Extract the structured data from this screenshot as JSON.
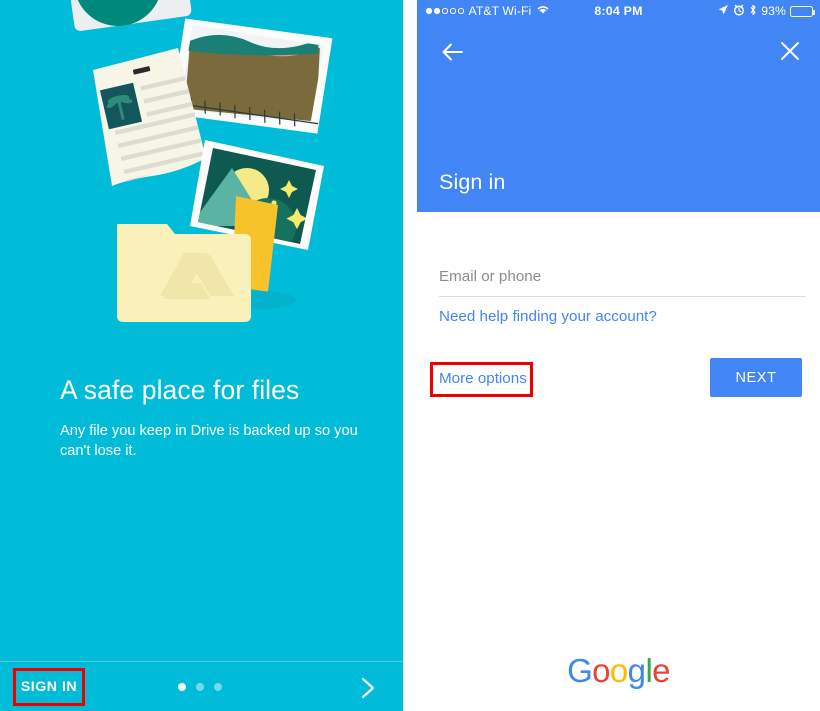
{
  "colors": {
    "teal_bg": "#00bcd8",
    "google_blue": "#4285f4",
    "highlight_red": "#ee0000",
    "white": "#ffffff",
    "hint_gray": "#8c8c8c",
    "divider_gray": "#dddddd",
    "google_red": "#ea4335",
    "google_yellow": "#fbbc05",
    "google_green": "#34a853"
  },
  "left_panel": {
    "name": "drive-onboarding-slide",
    "illustration_name": "files-folder-illustration",
    "headline": "A safe place for files",
    "subtext": "Any file you keep in Drive is backed up so you can't lose it.",
    "sign_in_label": "SIGN IN",
    "sign_in_highlighted": true,
    "pagination": {
      "total": 3,
      "active_index": 0
    },
    "next_arrow_icon": "chevron-right-icon"
  },
  "right_panel": {
    "status_bar": {
      "signal_dots_filled": 2,
      "signal_dots_total": 5,
      "carrier": "AT&T Wi-Fi",
      "wifi_icon": "wifi-icon",
      "time": "8:04 PM",
      "location_icon": "location-arrow-icon",
      "alarm_icon": "alarm-clock-icon",
      "bluetooth_icon": "bluetooth-icon",
      "battery_percent": "93%",
      "battery_level": 93
    },
    "header": {
      "back_icon": "arrow-left-icon",
      "close_icon": "close-x-icon",
      "title": "Sign in"
    },
    "form": {
      "email_placeholder": "Email or phone",
      "email_value": "",
      "help_link": "Need help finding your account?",
      "more_options": "More options",
      "more_options_highlighted": true,
      "next_button": "NEXT"
    },
    "footer": {
      "brand_letters": [
        {
          "char": "G",
          "color": "#4285f4"
        },
        {
          "char": "o",
          "color": "#ea4335"
        },
        {
          "char": "o",
          "color": "#fbbc05"
        },
        {
          "char": "g",
          "color": "#4285f4"
        },
        {
          "char": "l",
          "color": "#34a853"
        },
        {
          "char": "e",
          "color": "#ea4335"
        }
      ]
    }
  }
}
